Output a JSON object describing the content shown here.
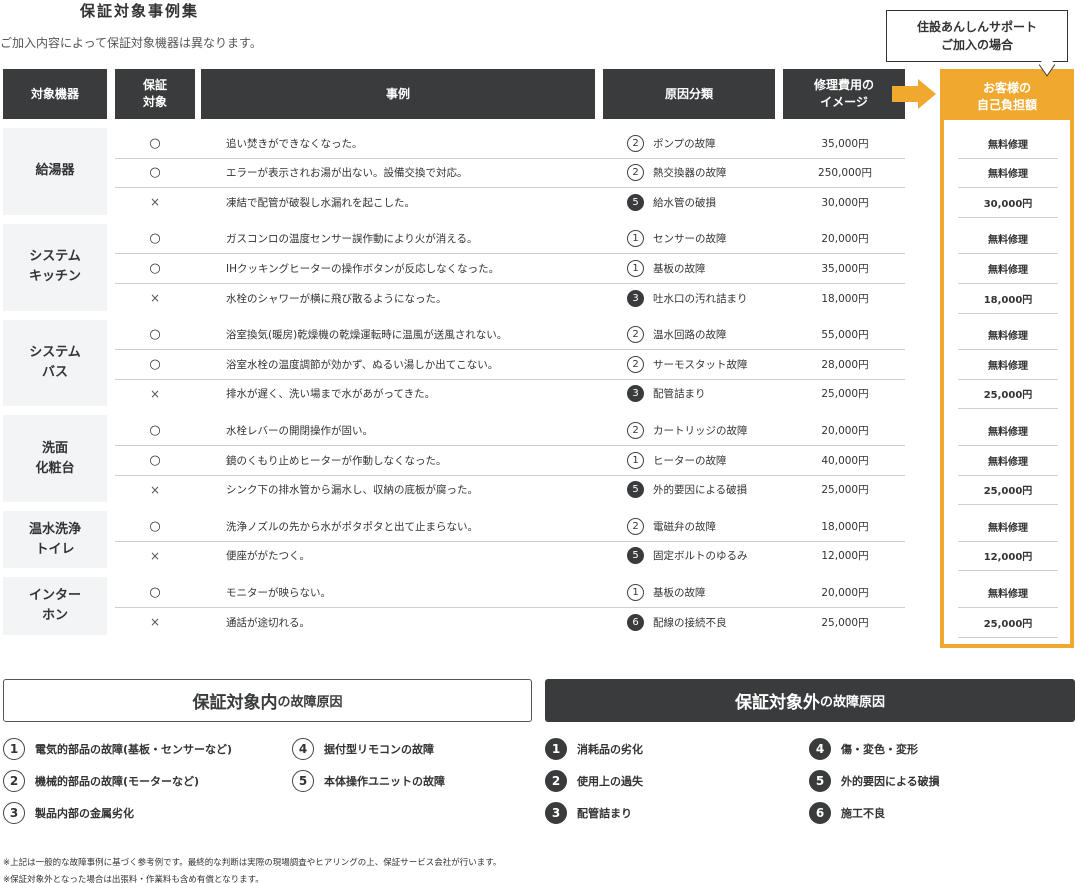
{
  "title": "保証対象事例集",
  "subtitle": "ご加入内容によって保証対象機器は異なります。",
  "callout": {
    "line1": "住設あんしんサポート",
    "line2": "ご加入の場合"
  },
  "headers": {
    "device": "対象機器",
    "covered_1": "保証",
    "covered_2": "対象",
    "example": "事例",
    "cause": "原因分類",
    "cost_1": "修理費用の",
    "cost_2": "イメージ",
    "pay_1": "お客様の",
    "pay_2": "自己負担額"
  },
  "groups": [
    {
      "label_1": "給湯器",
      "label_2": "",
      "rows": [
        {
          "mark": "○",
          "example": "追い焚きができなくなった。",
          "num": "2",
          "num_style": "o",
          "cause": "ポンプの故障",
          "cost": "35,000円",
          "pay": "無料修理"
        },
        {
          "mark": "○",
          "example": "エラーが表示されお湯が出ない。設備交換で対応。",
          "num": "2",
          "num_style": "o",
          "cause": "熱交換器の故障",
          "cost": "250,000円",
          "pay": "無料修理"
        },
        {
          "mark": "×",
          "example": "凍結で配管が破裂し水漏れを起こした。",
          "num": "5",
          "num_style": "f",
          "cause": "給水管の破損",
          "cost": "30,000円",
          "pay": "30,000円"
        }
      ]
    },
    {
      "label_1": "システム",
      "label_2": "キッチン",
      "rows": [
        {
          "mark": "○",
          "example": "ガスコンロの温度センサー誤作動により火が消える。",
          "num": "1",
          "num_style": "o",
          "cause": "センサーの故障",
          "cost": "20,000円",
          "pay": "無料修理"
        },
        {
          "mark": "○",
          "example": "IHクッキングヒーターの操作ボタンが反応しなくなった。",
          "num": "1",
          "num_style": "o",
          "cause": "基板の故障",
          "cost": "35,000円",
          "pay": "無料修理"
        },
        {
          "mark": "×",
          "example": "水栓のシャワーが横に飛び散るようになった。",
          "num": "3",
          "num_style": "f",
          "cause": "吐水口の汚れ詰まり",
          "cost": "18,000円",
          "pay": "18,000円"
        }
      ]
    },
    {
      "label_1": "システム",
      "label_2": "バス",
      "rows": [
        {
          "mark": "○",
          "example": "浴室換気(暖房)乾燥機の乾燥運転時に温風が送風されない。",
          "num": "2",
          "num_style": "o",
          "cause": "温水回路の故障",
          "cost": "55,000円",
          "pay": "無料修理"
        },
        {
          "mark": "○",
          "example": "浴室水栓の温度調節が効かず、ぬるい湯しか出てこない。",
          "num": "2",
          "num_style": "o",
          "cause": "サーモスタット故障",
          "cost": "28,000円",
          "pay": "無料修理"
        },
        {
          "mark": "×",
          "example": "排水が遅く、洗い場まで水があがってきた。",
          "num": "3",
          "num_style": "f",
          "cause": "配管詰まり",
          "cost": "25,000円",
          "pay": "25,000円"
        }
      ]
    },
    {
      "label_1": "洗面",
      "label_2": "化粧台",
      "rows": [
        {
          "mark": "○",
          "example": "水栓レバーの開閉操作が固い。",
          "num": "2",
          "num_style": "o",
          "cause": "カートリッジの故障",
          "cost": "20,000円",
          "pay": "無料修理"
        },
        {
          "mark": "○",
          "example": "鏡のくもり止めヒーターが作動しなくなった。",
          "num": "1",
          "num_style": "o",
          "cause": "ヒーターの故障",
          "cost": "40,000円",
          "pay": "無料修理"
        },
        {
          "mark": "×",
          "example": "シンク下の排水管から漏水し、収納の底板が腐った。",
          "num": "5",
          "num_style": "f",
          "cause": "外的要因による破損",
          "cost": "25,000円",
          "pay": "25,000円"
        }
      ]
    },
    {
      "label_1": "温水洗浄",
      "label_2": "トイレ",
      "rows": [
        {
          "mark": "○",
          "example": "洗浄ノズルの先から水がポタポタと出て止まらない。",
          "num": "2",
          "num_style": "o",
          "cause": "電磁弁の故障",
          "cost": "18,000円",
          "pay": "無料修理"
        },
        {
          "mark": "×",
          "example": "便座ががたつく。",
          "num": "5",
          "num_style": "f",
          "cause": "固定ボルトのゆるみ",
          "cost": "12,000円",
          "pay": "12,000円"
        }
      ]
    },
    {
      "label_1": "インター",
      "label_2": "ホン",
      "rows": [
        {
          "mark": "○",
          "example": "モニターが映らない。",
          "num": "1",
          "num_style": "o",
          "cause": "基板の故障",
          "cost": "20,000円",
          "pay": "無料修理"
        },
        {
          "mark": "×",
          "example": "通話が途切れる。",
          "num": "6",
          "num_style": "f",
          "cause": "配線の接続不良",
          "cost": "25,000円",
          "pay": "25,000円"
        }
      ]
    }
  ],
  "covered_box": {
    "big": "保証対象内",
    "small": "の故障原因"
  },
  "uncovered_box": {
    "big": "保証対象外",
    "small": "の故障原因"
  },
  "covered_causes": [
    {
      "num": "1",
      "label": "電気的部品の故障(基板・センサーなど)"
    },
    {
      "num": "2",
      "label": "機械的部品の故障(モーターなど)"
    },
    {
      "num": "3",
      "label": "製品内部の金属劣化"
    },
    {
      "num": "4",
      "label": "据付型リモコンの故障"
    },
    {
      "num": "5",
      "label": "本体操作ユニットの故障"
    }
  ],
  "uncovered_causes": [
    {
      "num": "1",
      "label": "消耗品の劣化"
    },
    {
      "num": "2",
      "label": "使用上の過失"
    },
    {
      "num": "3",
      "label": "配管詰まり"
    },
    {
      "num": "4",
      "label": "傷・変色・変形"
    },
    {
      "num": "5",
      "label": "外的要因による破損"
    },
    {
      "num": "6",
      "label": "施工不良"
    }
  ],
  "notes": [
    "※上記は一般的な故障事例に基づく参考例です。最終的な判断は実際の現場調査やヒアリングの上、保証サービス会社が行います。",
    "※保証対象外となった場合は出張料・作業料も含め有償となります。"
  ],
  "colors": {
    "accent": "#f0a92e",
    "dark": "#3a3b3d",
    "label_bg": "#f3f4f6"
  }
}
